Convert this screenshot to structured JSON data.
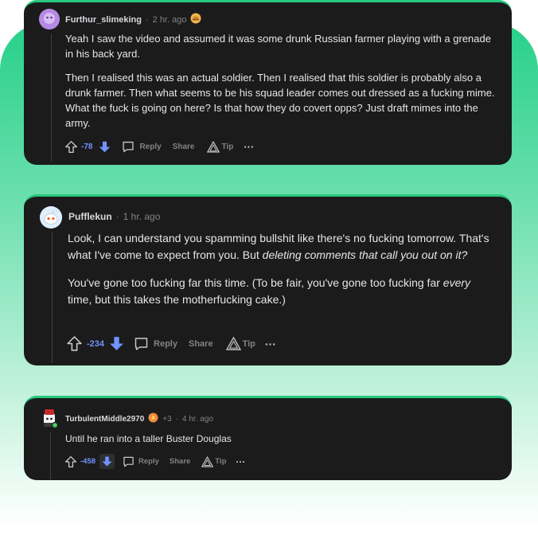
{
  "comments": [
    {
      "username": "Furthur_slimeking",
      "sep": "·",
      "time": "2 hr. ago",
      "paragraphs": [
        "Yeah I saw the video and assumed it was some drunk Russian farmer playing with a grenade in his back yard.",
        "Then I realised this was an actual soldier. Then I realised that this soldier is probably also a drunk farmer. Then what seems to be his squad leader comes out dressed as a fucking mime. What the fuck is going on here? Is that how they do covert opps? Just draft mimes into the army."
      ],
      "score": "-78",
      "reply": "Reply",
      "share": "Share",
      "tip": "Tip",
      "more": "···"
    },
    {
      "username": "Pufflekun",
      "sep": "·",
      "time": "1 hr. ago",
      "p1_a": "Look, I can understand you spamming bullshit like there's no fucking tomorrow. That's what I've come to expect from you. But ",
      "p1_em": "deleting comments that call you out on it?",
      "p2_a": "You've gone too fucking far this time. (To be fair, you've gone too fucking far ",
      "p2_em": "every",
      "p2_b": " time, but this takes the motherfucking cake.)",
      "score": "-234",
      "reply": "Reply",
      "share": "Share",
      "tip": "Tip",
      "more": "···"
    },
    {
      "username": "TurbulentMiddle2970",
      "award_count": "+3",
      "sep": "·",
      "time": "4 hr. ago",
      "text": "Until he ran into a taller Buster Douglas",
      "score": "-458",
      "reply": "Reply",
      "share": "Share",
      "tip": "Tip",
      "more": "···"
    }
  ],
  "colors": {
    "card_bg": "#1b1b1c",
    "card_border": "#28c77e",
    "downvote": "#7193ff",
    "muted": "#818384",
    "text": "#e6e6e6"
  }
}
